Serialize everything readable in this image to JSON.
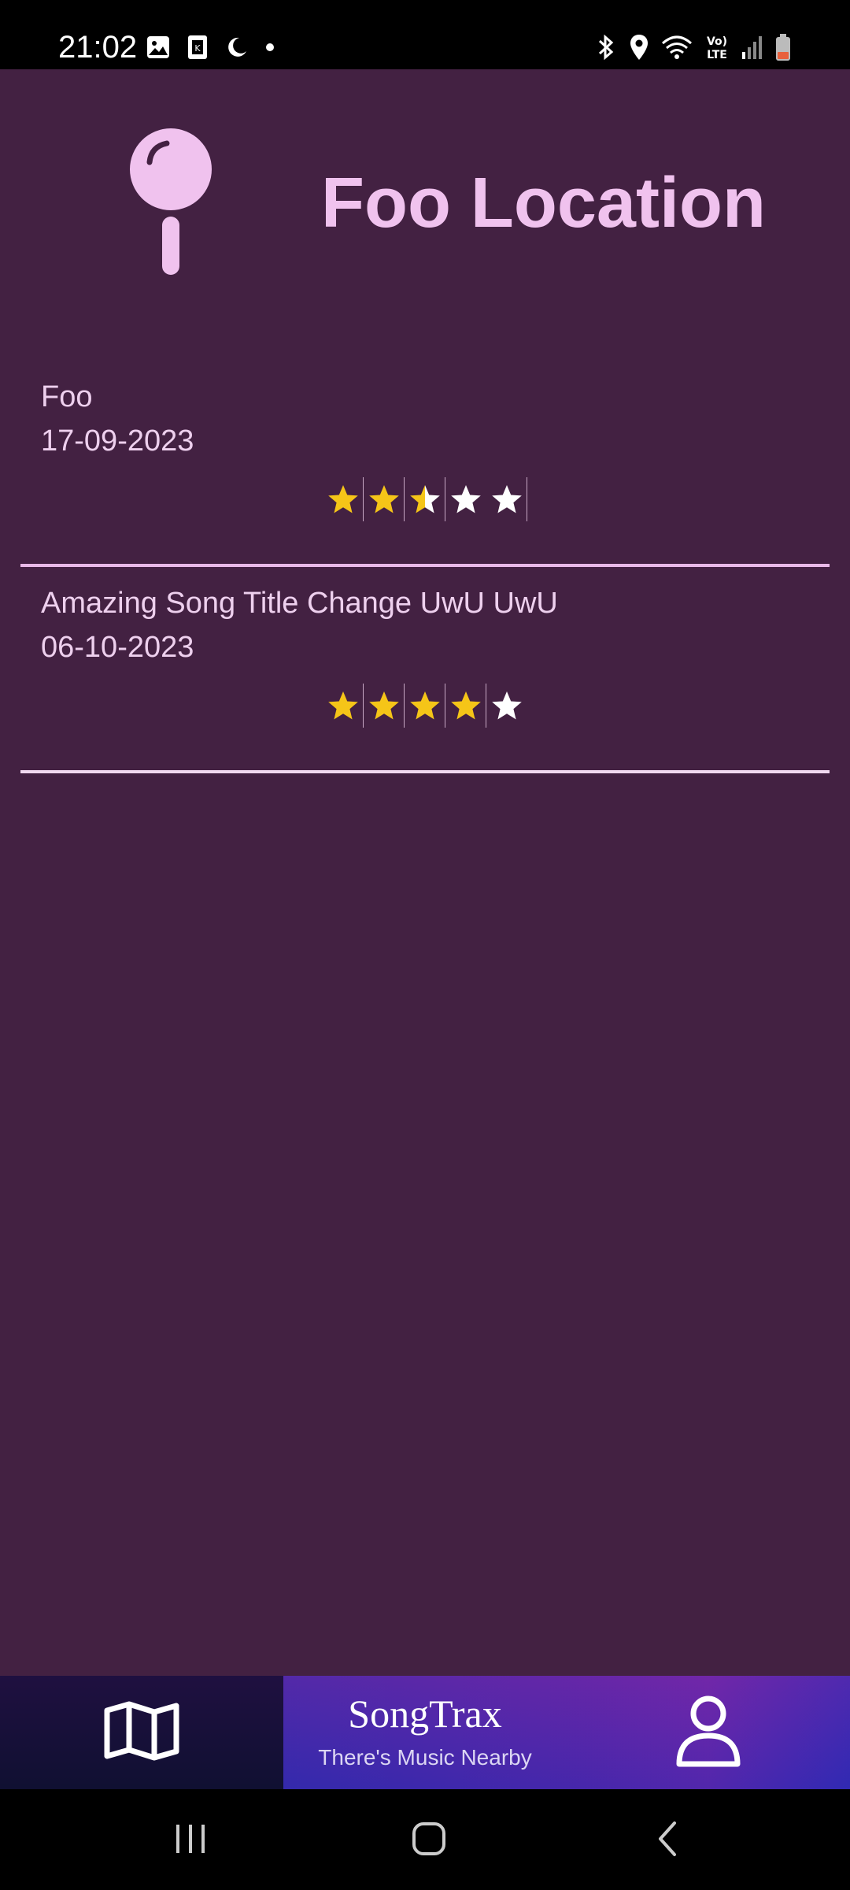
{
  "status_bar": {
    "time": "21:02",
    "left_icons": [
      "gallery-icon",
      "k-app-icon",
      "moon-icon",
      "dot-icon"
    ],
    "right_icons": [
      "bluetooth-icon",
      "location-icon",
      "wifi-icon",
      "volte-icon",
      "signal-icon",
      "battery-icon"
    ],
    "volte_text": "Vo) LTE"
  },
  "header": {
    "icon": "map-pin-icon",
    "title": "Foo Location"
  },
  "songs": [
    {
      "title": "Foo",
      "date": "17-09-2023",
      "rating": 2.5,
      "max_rating": 5
    },
    {
      "title": "Amazing Song Title Change UwU UwU",
      "date": "06-10-2023",
      "rating": 4,
      "max_rating": 5
    }
  ],
  "bottom_nav": {
    "map_icon": "map-icon",
    "brand_name": "SongTrax",
    "tagline": "There's Music Nearby",
    "profile_icon": "profile-icon"
  },
  "system_nav": {
    "recents": "recents-icon",
    "home": "home-icon",
    "back": "back-icon"
  },
  "colors": {
    "background": "#432142",
    "accent_pink": "#f0c2ee",
    "star_filled": "#f5c518",
    "star_empty": "#ffffff"
  }
}
